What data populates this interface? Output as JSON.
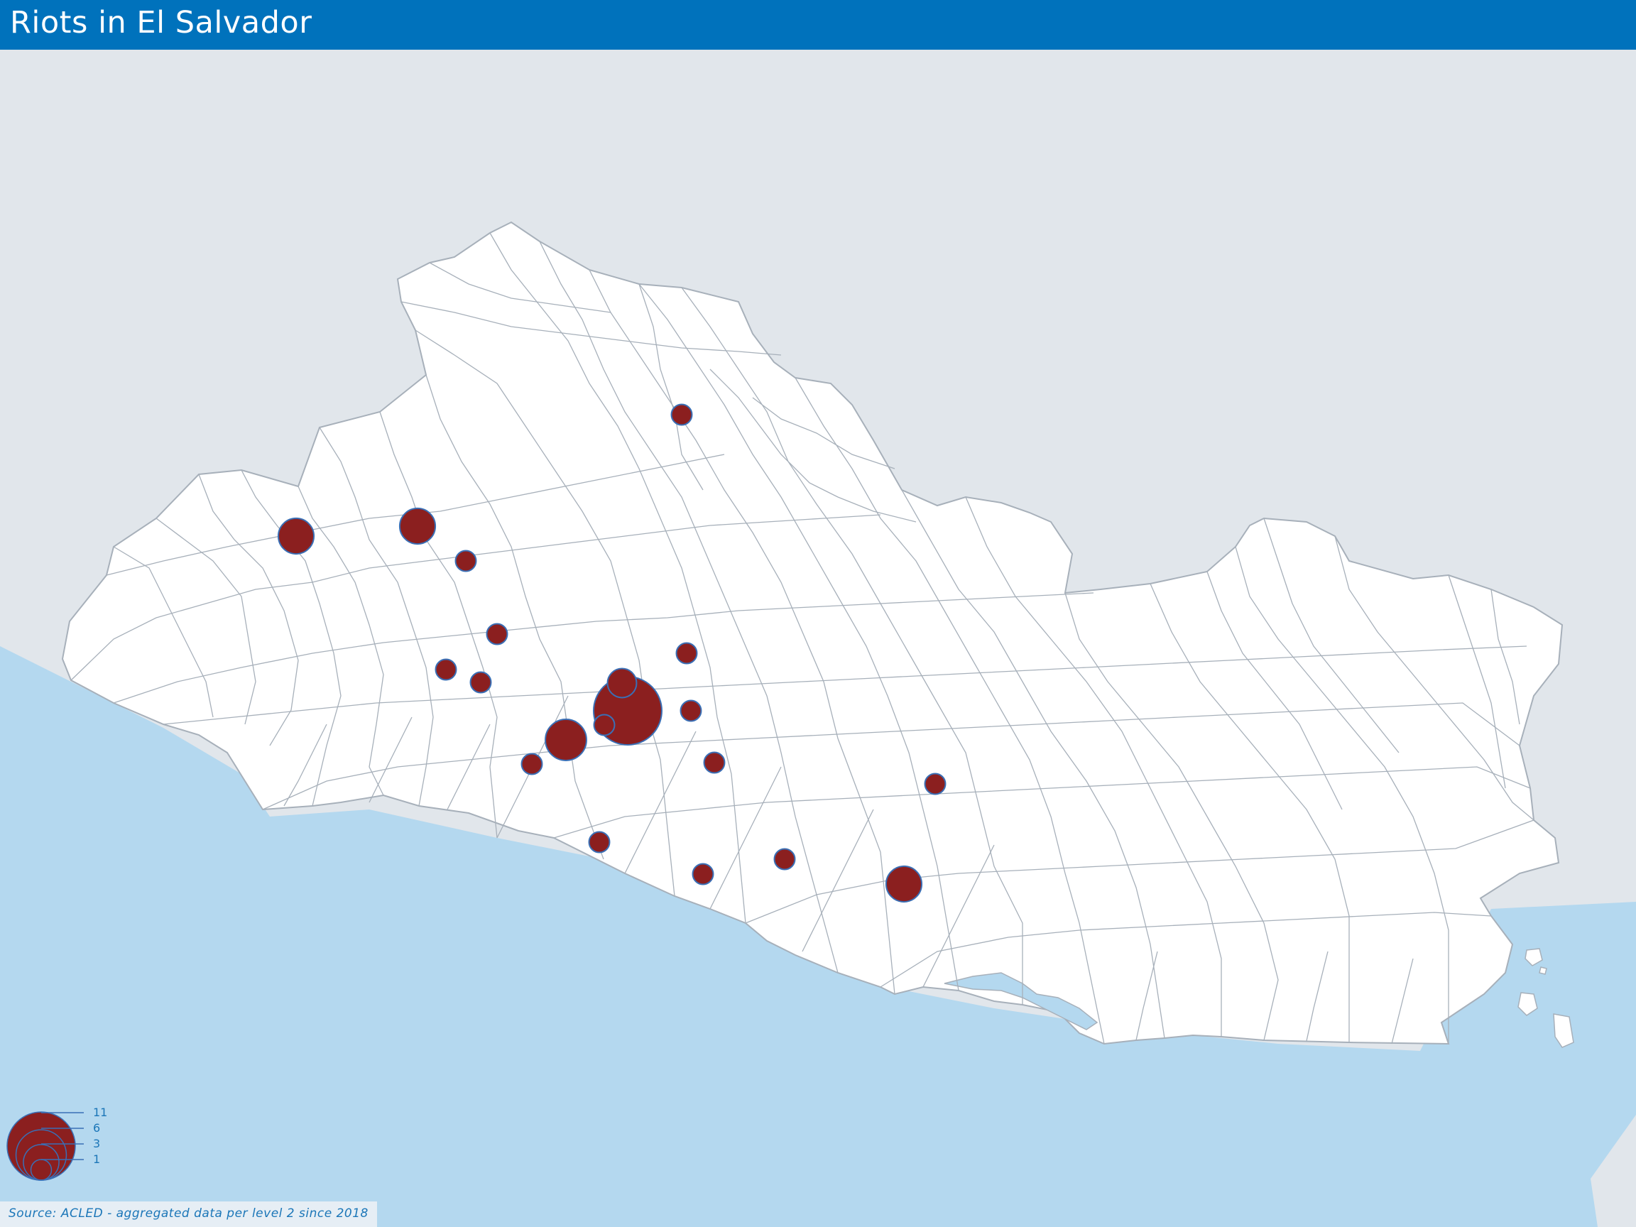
{
  "title": "Riots in El Salvador",
  "source": "Source: ACLED - aggregated data per level 2 since 2018",
  "colors": {
    "header": "#0072bc",
    "sea": "#b4d8ef",
    "land_outside": "#e1e6eb",
    "country_fill": "#ffffff",
    "boundary": "#a7b0ba",
    "bubble_fill": "#8b1f1f",
    "bubble_stroke": "#3a6fb5"
  },
  "legend": {
    "items": [
      {
        "label": "11",
        "value": 11
      },
      {
        "label": "6",
        "value": 6
      },
      {
        "label": "3",
        "value": 3
      },
      {
        "label": "1",
        "value": 1
      }
    ]
  },
  "events": [
    {
      "value": 3
    },
    {
      "value": 3
    },
    {
      "value": 1
    },
    {
      "value": 1
    },
    {
      "value": 1
    },
    {
      "value": 1
    },
    {
      "value": 1
    },
    {
      "value": 1
    },
    {
      "value": 11
    },
    {
      "value": 2
    },
    {
      "value": 1
    },
    {
      "value": 1
    },
    {
      "value": 1
    },
    {
      "value": 4
    },
    {
      "value": 1
    },
    {
      "value": 1
    },
    {
      "value": 1
    },
    {
      "value": 1
    },
    {
      "value": 1
    },
    {
      "value": 3
    }
  ]
}
